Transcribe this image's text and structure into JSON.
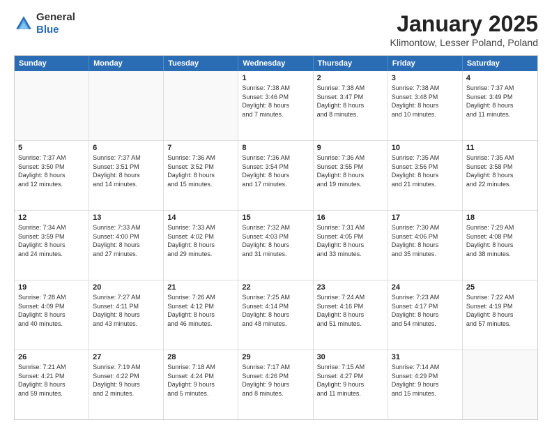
{
  "header": {
    "logo_general": "General",
    "logo_blue": "Blue",
    "month_title": "January 2025",
    "location": "Klimontow, Lesser Poland, Poland"
  },
  "weekdays": [
    "Sunday",
    "Monday",
    "Tuesday",
    "Wednesday",
    "Thursday",
    "Friday",
    "Saturday"
  ],
  "weeks": [
    [
      {
        "day": "",
        "detail": ""
      },
      {
        "day": "",
        "detail": ""
      },
      {
        "day": "",
        "detail": ""
      },
      {
        "day": "1",
        "detail": "Sunrise: 7:38 AM\nSunset: 3:46 PM\nDaylight: 8 hours\nand 7 minutes."
      },
      {
        "day": "2",
        "detail": "Sunrise: 7:38 AM\nSunset: 3:47 PM\nDaylight: 8 hours\nand 8 minutes."
      },
      {
        "day": "3",
        "detail": "Sunrise: 7:38 AM\nSunset: 3:48 PM\nDaylight: 8 hours\nand 10 minutes."
      },
      {
        "day": "4",
        "detail": "Sunrise: 7:37 AM\nSunset: 3:49 PM\nDaylight: 8 hours\nand 11 minutes."
      }
    ],
    [
      {
        "day": "5",
        "detail": "Sunrise: 7:37 AM\nSunset: 3:50 PM\nDaylight: 8 hours\nand 12 minutes."
      },
      {
        "day": "6",
        "detail": "Sunrise: 7:37 AM\nSunset: 3:51 PM\nDaylight: 8 hours\nand 14 minutes."
      },
      {
        "day": "7",
        "detail": "Sunrise: 7:36 AM\nSunset: 3:52 PM\nDaylight: 8 hours\nand 15 minutes."
      },
      {
        "day": "8",
        "detail": "Sunrise: 7:36 AM\nSunset: 3:54 PM\nDaylight: 8 hours\nand 17 minutes."
      },
      {
        "day": "9",
        "detail": "Sunrise: 7:36 AM\nSunset: 3:55 PM\nDaylight: 8 hours\nand 19 minutes."
      },
      {
        "day": "10",
        "detail": "Sunrise: 7:35 AM\nSunset: 3:56 PM\nDaylight: 8 hours\nand 21 minutes."
      },
      {
        "day": "11",
        "detail": "Sunrise: 7:35 AM\nSunset: 3:58 PM\nDaylight: 8 hours\nand 22 minutes."
      }
    ],
    [
      {
        "day": "12",
        "detail": "Sunrise: 7:34 AM\nSunset: 3:59 PM\nDaylight: 8 hours\nand 24 minutes."
      },
      {
        "day": "13",
        "detail": "Sunrise: 7:33 AM\nSunset: 4:00 PM\nDaylight: 8 hours\nand 27 minutes."
      },
      {
        "day": "14",
        "detail": "Sunrise: 7:33 AM\nSunset: 4:02 PM\nDaylight: 8 hours\nand 29 minutes."
      },
      {
        "day": "15",
        "detail": "Sunrise: 7:32 AM\nSunset: 4:03 PM\nDaylight: 8 hours\nand 31 minutes."
      },
      {
        "day": "16",
        "detail": "Sunrise: 7:31 AM\nSunset: 4:05 PM\nDaylight: 8 hours\nand 33 minutes."
      },
      {
        "day": "17",
        "detail": "Sunrise: 7:30 AM\nSunset: 4:06 PM\nDaylight: 8 hours\nand 35 minutes."
      },
      {
        "day": "18",
        "detail": "Sunrise: 7:29 AM\nSunset: 4:08 PM\nDaylight: 8 hours\nand 38 minutes."
      }
    ],
    [
      {
        "day": "19",
        "detail": "Sunrise: 7:28 AM\nSunset: 4:09 PM\nDaylight: 8 hours\nand 40 minutes."
      },
      {
        "day": "20",
        "detail": "Sunrise: 7:27 AM\nSunset: 4:11 PM\nDaylight: 8 hours\nand 43 minutes."
      },
      {
        "day": "21",
        "detail": "Sunrise: 7:26 AM\nSunset: 4:12 PM\nDaylight: 8 hours\nand 46 minutes."
      },
      {
        "day": "22",
        "detail": "Sunrise: 7:25 AM\nSunset: 4:14 PM\nDaylight: 8 hours\nand 48 minutes."
      },
      {
        "day": "23",
        "detail": "Sunrise: 7:24 AM\nSunset: 4:16 PM\nDaylight: 8 hours\nand 51 minutes."
      },
      {
        "day": "24",
        "detail": "Sunrise: 7:23 AM\nSunset: 4:17 PM\nDaylight: 8 hours\nand 54 minutes."
      },
      {
        "day": "25",
        "detail": "Sunrise: 7:22 AM\nSunset: 4:19 PM\nDaylight: 8 hours\nand 57 minutes."
      }
    ],
    [
      {
        "day": "26",
        "detail": "Sunrise: 7:21 AM\nSunset: 4:21 PM\nDaylight: 8 hours\nand 59 minutes."
      },
      {
        "day": "27",
        "detail": "Sunrise: 7:19 AM\nSunset: 4:22 PM\nDaylight: 9 hours\nand 2 minutes."
      },
      {
        "day": "28",
        "detail": "Sunrise: 7:18 AM\nSunset: 4:24 PM\nDaylight: 9 hours\nand 5 minutes."
      },
      {
        "day": "29",
        "detail": "Sunrise: 7:17 AM\nSunset: 4:26 PM\nDaylight: 9 hours\nand 8 minutes."
      },
      {
        "day": "30",
        "detail": "Sunrise: 7:15 AM\nSunset: 4:27 PM\nDaylight: 9 hours\nand 11 minutes."
      },
      {
        "day": "31",
        "detail": "Sunrise: 7:14 AM\nSunset: 4:29 PM\nDaylight: 9 hours\nand 15 minutes."
      },
      {
        "day": "",
        "detail": ""
      }
    ]
  ]
}
